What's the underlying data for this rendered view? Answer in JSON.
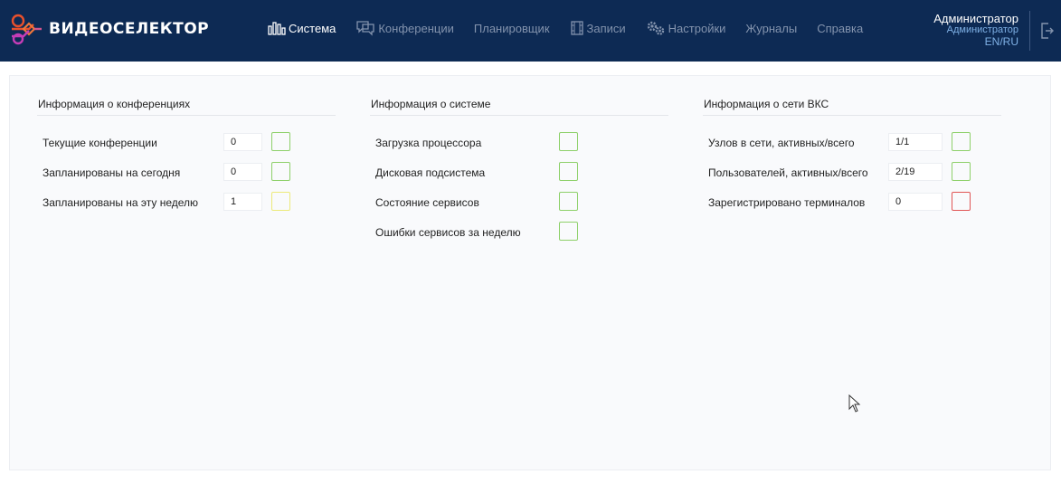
{
  "brand": {
    "name": "ВИДЕОСЕЛЕКТОР",
    "logo_colors": [
      "#e8502c",
      "#c43db6"
    ]
  },
  "nav": [
    {
      "label": "Система",
      "icon": "chart-bars-icon",
      "active": true
    },
    {
      "label": "Конференции",
      "icon": "chat-bubbles-icon",
      "active": false
    },
    {
      "label": "Планировщик",
      "icon": "",
      "active": false
    },
    {
      "label": "Записи",
      "icon": "film-icon",
      "active": false
    },
    {
      "label": "Настройки",
      "icon": "gears-icon",
      "active": false
    },
    {
      "label": "Журналы",
      "icon": "",
      "active": false
    },
    {
      "label": "Справка",
      "icon": "",
      "active": false
    }
  ],
  "user": {
    "name": "Администратор",
    "role": "Администратор",
    "lang": "EN/RU"
  },
  "sections": [
    {
      "title": "Информация о конференциях",
      "rows": [
        {
          "label": "Текущие конференции",
          "value": "0",
          "status": "green"
        },
        {
          "label": "Запланированы на сегодня",
          "value": "0",
          "status": "green"
        },
        {
          "label": "Запланированы на эту неделю",
          "value": "1",
          "status": "yellow"
        }
      ]
    },
    {
      "title": "Информация о системе",
      "rows": [
        {
          "label": "Загрузка процессора",
          "status": "green"
        },
        {
          "label": "Дисковая подсистема",
          "status": "green"
        },
        {
          "label": "Состояние сервисов",
          "status": "green"
        },
        {
          "label": "Ошибки сервисов за неделю",
          "status": "green"
        }
      ]
    },
    {
      "title": "Информация о сети ВКС",
      "rows": [
        {
          "label": "Узлов в сети, активных/всего",
          "value": "1/1",
          "status": "green"
        },
        {
          "label": "Пользователей, активных/всего",
          "value": "2/19",
          "status": "green"
        },
        {
          "label": "Зарегистрировано терминалов",
          "value": "0",
          "status": "red"
        }
      ]
    }
  ],
  "colors": {
    "header_bg": "#0d2a54",
    "nav_inactive": "#8393ad",
    "accent_link": "#7fb1e6",
    "status_green": "#8ed06a",
    "status_yellow": "#ecea7a",
    "status_red": "#e05555"
  }
}
